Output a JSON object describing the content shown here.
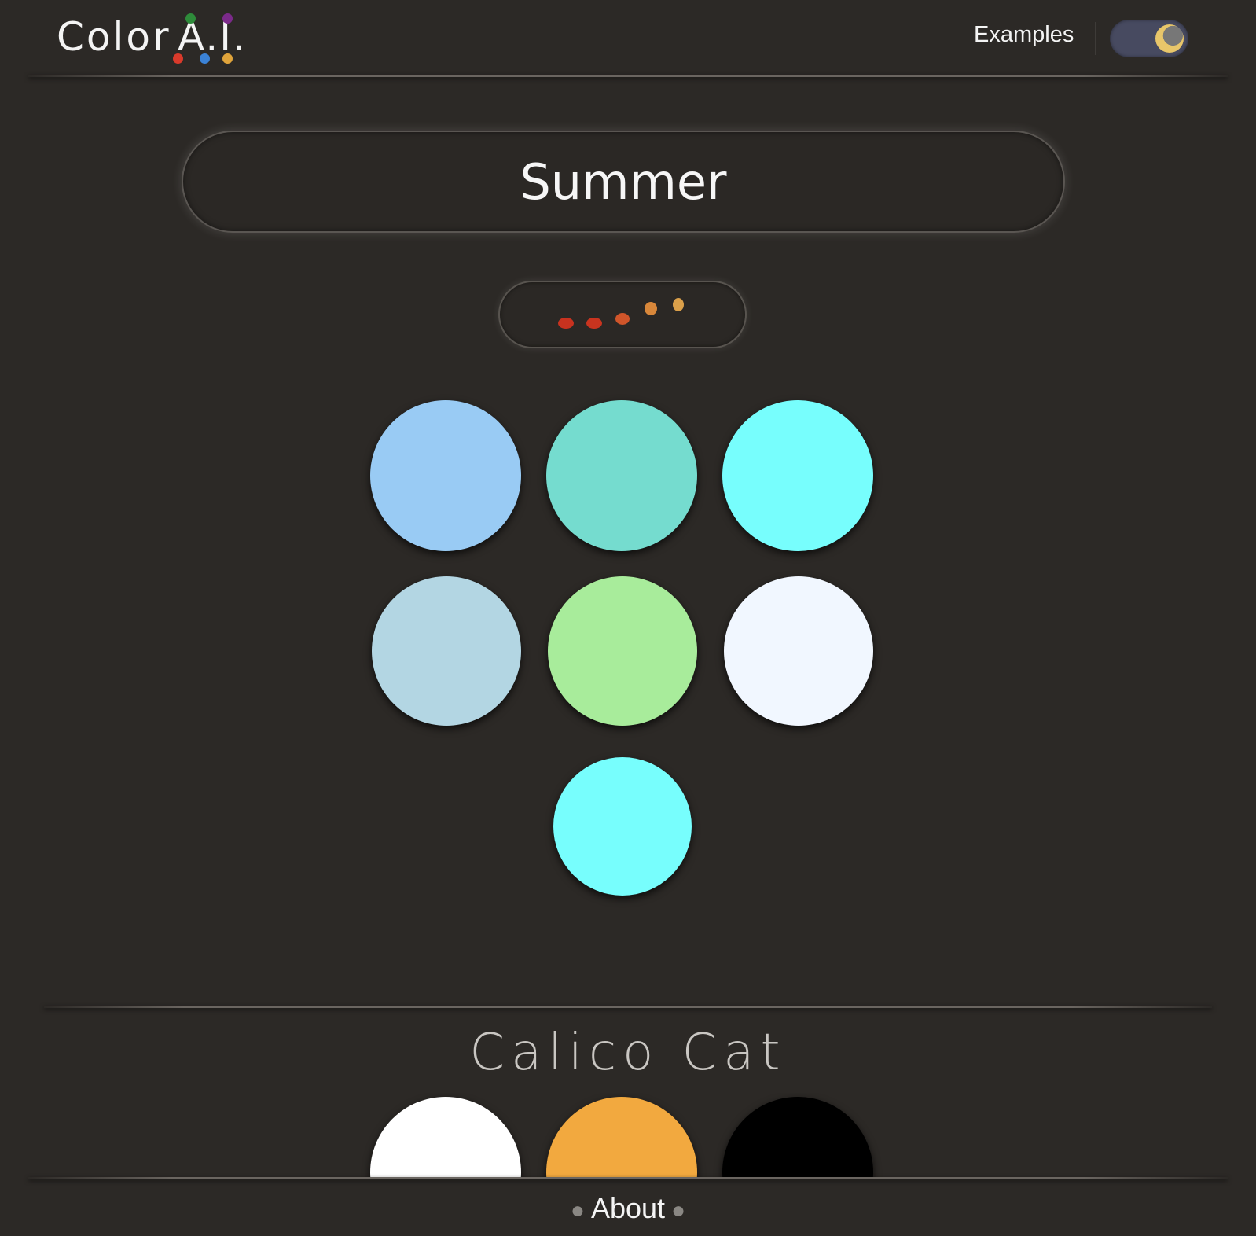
{
  "header": {
    "logo_text": "Color",
    "logo_accent": "A.I.",
    "logo_dot_colors": [
      "#d93a2b",
      "#2e8b3a",
      "#3b82d6",
      "#7b2a8a",
      "#e0a43b"
    ],
    "examples_label": "Examples",
    "theme_toggle": {
      "icon": "moon-icon",
      "track_color": "#474a60",
      "knob_color": "#e8c66a"
    }
  },
  "search": {
    "value": "Summer",
    "placeholder": ""
  },
  "loader": {
    "dot_colors": [
      "#c8321f",
      "#c9341f",
      "#d0552a",
      "#d8873a",
      "#dba04a"
    ]
  },
  "palette": {
    "swatches": [
      "#99cbf4",
      "#75dccf",
      "#77fefd",
      "#b3d6e3",
      "#a8ec9b",
      "#f1f7ff",
      "#77fefd"
    ]
  },
  "example": {
    "title": "Calico Cat",
    "swatches": [
      "#ffffff",
      "#f2a93f",
      "#000000"
    ]
  },
  "footer": {
    "about_label": "About"
  }
}
